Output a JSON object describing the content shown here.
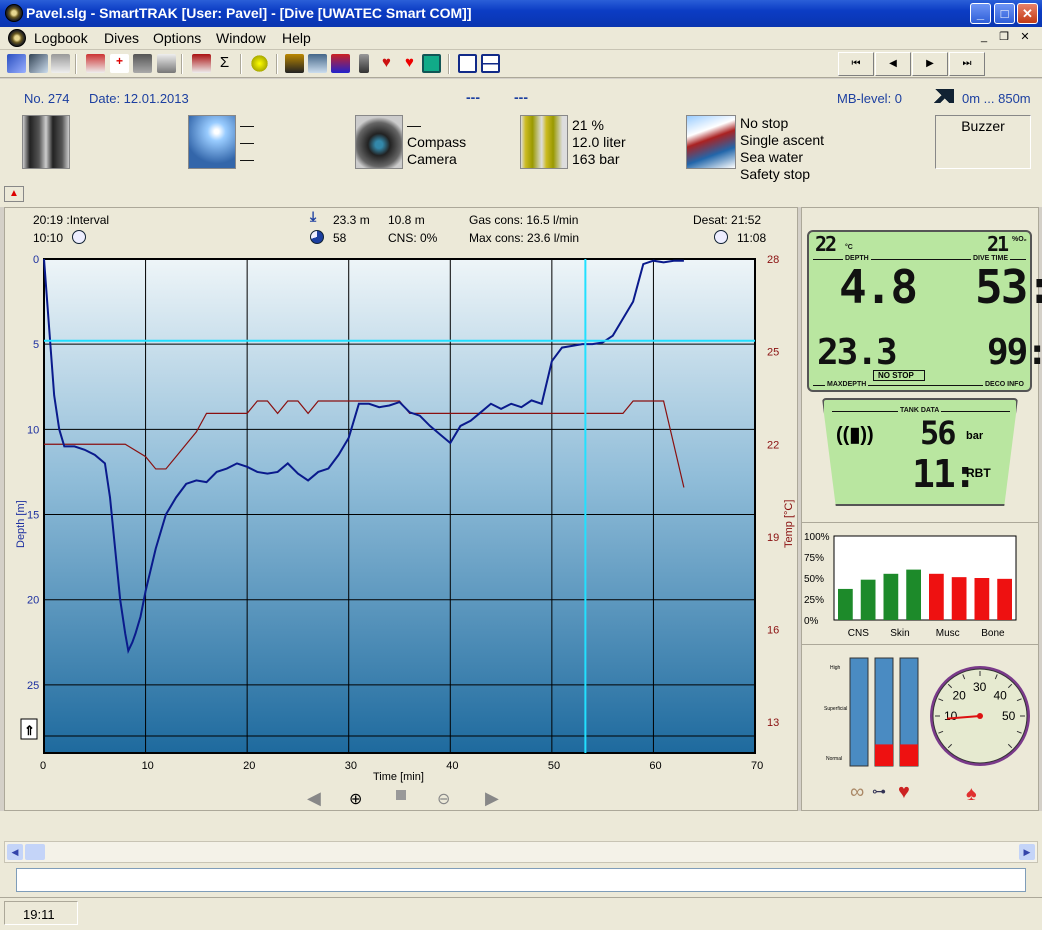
{
  "window": {
    "title": "Pavel.slg - SmartTRAK  [User: Pavel] - [Dive  [UWATEC Smart COM]]",
    "min": "_",
    "max": "□",
    "close": "✕"
  },
  "menu": {
    "logbook": "Logbook",
    "dives": "Dives",
    "options": "Options",
    "window": "Window",
    "help": "Help",
    "mdi_min": "_",
    "mdi_restore": "❐",
    "mdi_close": "✕"
  },
  "nav": {
    "first": "⏮",
    "prev": "◀",
    "next": "▶",
    "last": "⏭"
  },
  "dive": {
    "no": "No. 274",
    "date": "Date: 12.01.2013",
    "dash1": "---",
    "dash2": "---",
    "mb": "MB-level: 0",
    "alt": "0m ... 850m",
    "weather": [
      "—",
      "—",
      "—"
    ],
    "equip": [
      "—",
      "Compass",
      "Camera"
    ],
    "gas": [
      "21 %",
      "12.0 liter",
      "163 bar"
    ],
    "cond": [
      "No stop",
      "Single ascent",
      "Sea water",
      "Safety stop"
    ],
    "buzzer": "Buzzer"
  },
  "stats": {
    "interval": "20:19 :Interval",
    "entry": "10:10",
    "maxdepth": "23.3 m",
    "avgdepth": "10.8 m",
    "gascons": "Gas cons: 16.5 l/min",
    "desat": "Desat: 21:52",
    "duration": "58",
    "cns": "CNS:  0%",
    "maxcons": "Max cons: 23.6 l/min",
    "exit": "11:08"
  },
  "chart_data": {
    "type": "line",
    "xlabel": "Time [min]",
    "ylabel": "Depth [m]",
    "y2label": "Temp [°C]",
    "xticks": [
      "0",
      "10",
      "20",
      "30",
      "40",
      "50",
      "60",
      "70"
    ],
    "yticks": [
      "0",
      "5",
      "10",
      "15",
      "20",
      "25"
    ],
    "y2ticks": [
      "28",
      "25",
      "22",
      "19",
      "16",
      "13"
    ],
    "xlim": [
      0,
      70
    ],
    "ylim": [
      0,
      29
    ],
    "y2lim": [
      12,
      28
    ],
    "grid": true,
    "series": [
      {
        "name": "depth",
        "color": "#0a1a8c",
        "x": [
          0,
          0.5,
          1,
          1.5,
          2,
          3,
          4,
          5,
          6,
          6.5,
          7,
          7.5,
          8,
          8.3,
          8.7,
          9,
          9.5,
          10,
          11,
          12,
          13,
          14,
          15,
          16,
          17,
          18,
          19,
          20,
          21,
          22,
          23,
          24,
          25,
          26,
          27,
          28,
          29,
          30,
          31,
          32,
          33,
          34,
          35,
          36,
          37,
          38,
          39,
          40,
          41,
          42,
          43,
          44,
          45,
          46,
          47,
          48,
          49,
          50,
          51,
          52,
          53,
          54,
          55,
          56,
          57,
          58,
          59,
          60,
          61,
          62,
          63
        ],
        "y": [
          0,
          4,
          8,
          10,
          11,
          11,
          11.2,
          11.5,
          12,
          14,
          17,
          20,
          22,
          23,
          22.5,
          22,
          21,
          19.5,
          17,
          15,
          14,
          13.2,
          13,
          13.1,
          12.5,
          12.3,
          12,
          12.2,
          12.5,
          12.6,
          12.5,
          12,
          12.6,
          13,
          12.5,
          12.3,
          11.5,
          10.5,
          8.5,
          8.5,
          8.7,
          8.6,
          8.4,
          9,
          9.2,
          9.8,
          10.3,
          10.8,
          9.8,
          9.5,
          9,
          8.5,
          8.8,
          8.5,
          8.7,
          8.3,
          8.5,
          6,
          5.2,
          5.1,
          5,
          5,
          4.9,
          4.5,
          3.5,
          2.5,
          0.3,
          0.1,
          0.2,
          0.1,
          0.1
        ]
      },
      {
        "name": "temperature",
        "color": "#8a1010",
        "x": [
          0,
          2,
          5,
          8,
          10,
          11,
          12,
          13,
          14,
          15,
          16,
          17,
          20,
          21,
          22,
          23,
          24,
          25,
          26,
          27,
          28,
          29,
          30,
          31,
          32,
          33,
          34,
          35,
          36,
          38,
          40,
          45,
          50,
          55,
          57,
          58,
          59,
          60,
          61,
          62,
          63
        ],
        "y": [
          22,
          22,
          22,
          22,
          21.6,
          21.2,
          21.2,
          21.6,
          22,
          22.4,
          23,
          23,
          23,
          23.4,
          23.4,
          23,
          23.4,
          23.4,
          23,
          23.4,
          23.4,
          23.4,
          23.4,
          23.4,
          23.4,
          23.4,
          23.4,
          23.4,
          23,
          23,
          23,
          23,
          23,
          23,
          23,
          23.4,
          23.4,
          23.4,
          23.4,
          22,
          20.6
        ]
      }
    ],
    "hline_depth": 4.8,
    "vline_time": 53.3
  },
  "lcd": {
    "temp": "22",
    "tempunit": "°C",
    "o2": "21",
    "o2unit": "%O₂",
    "depth_lbl": "DEPTH",
    "time_lbl": "DIVE TIME",
    "depth": "4.8",
    "divetime": "53:",
    "maxdepth": "23.3",
    "nostop": "NO STOP",
    "deco": "99:",
    "maxdepth_lbl": "MAXDEPTH",
    "deco_lbl": "DECO INFO",
    "tank_lbl": "TANK DATA",
    "tank": "56",
    "bar": "bar",
    "rbt": "11:",
    "rbt_lbl": "RBT"
  },
  "tissue": {
    "yticks": [
      "100%",
      "75%",
      "50%",
      "25%",
      "0%"
    ],
    "labels": [
      "CNS",
      "Skin",
      "Musc",
      "Bone"
    ],
    "values": [
      0.37,
      0.48,
      0.55,
      0.6,
      0.55,
      0.51,
      0.5,
      0.49
    ],
    "colors": [
      "#1d8a2a",
      "#1d8a2a",
      "#1d8a2a",
      "#1d8a2a",
      "#ee1111",
      "#ee1111",
      "#ee1111",
      "#ee1111"
    ]
  },
  "gauges": {
    "levels": [
      "High",
      "Superficial",
      "Normal"
    ],
    "fills": [
      0,
      0.2,
      0.2
    ],
    "dial": [
      "10",
      "20",
      "30",
      "40",
      "50"
    ],
    "dial_value": 9
  },
  "status": {
    "time": "19:11"
  }
}
